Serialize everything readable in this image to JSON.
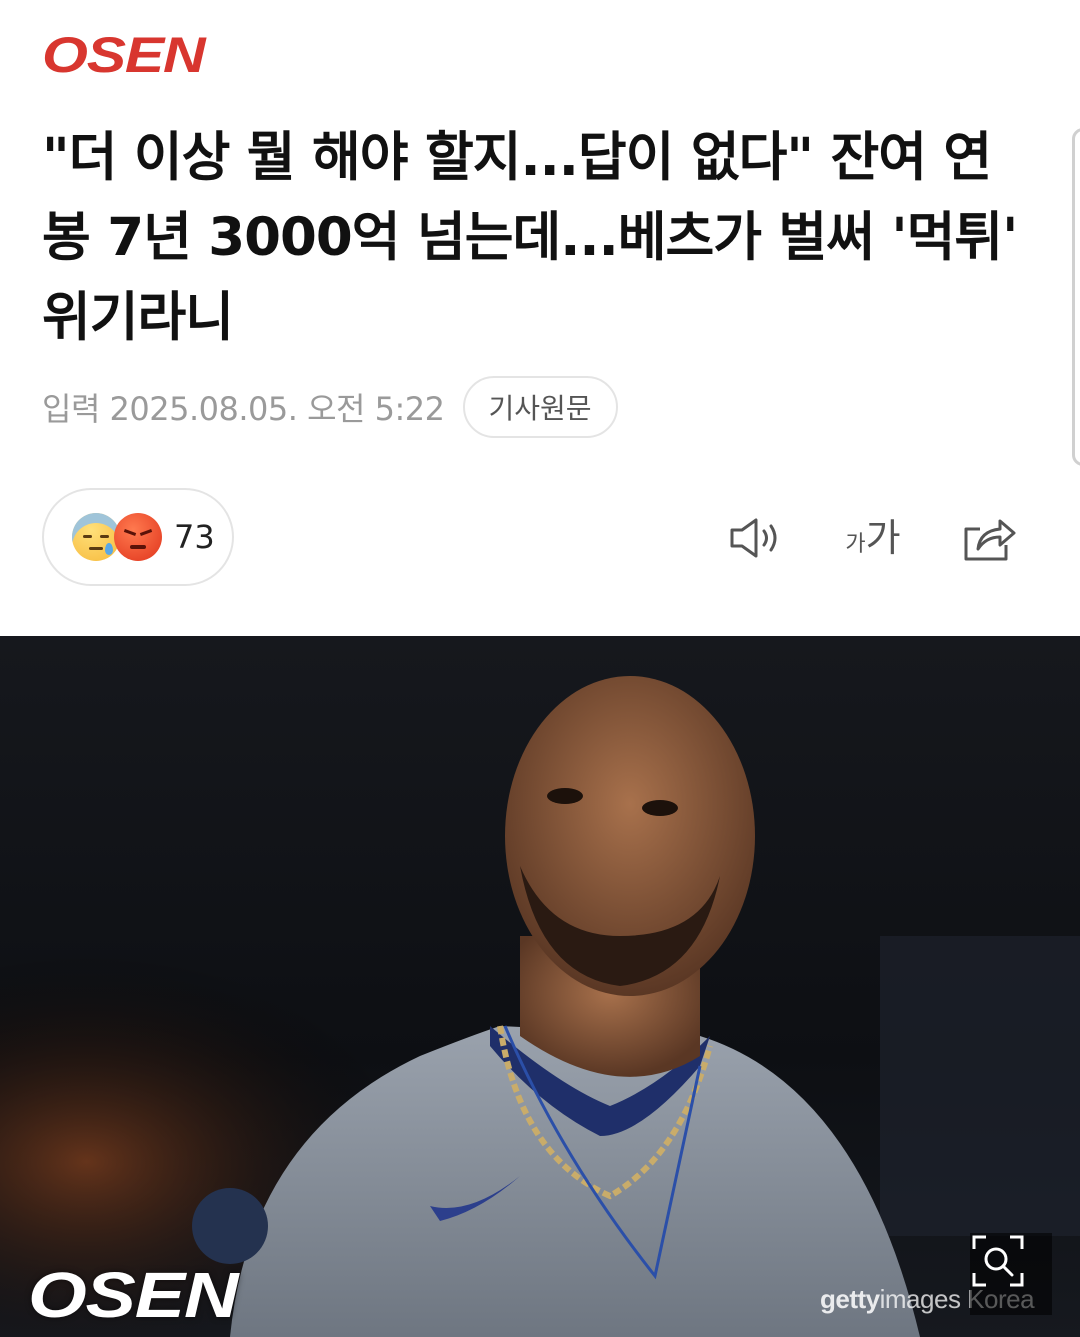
{
  "header": {
    "logo_text": "OSEN",
    "brand_color": "#d8362f"
  },
  "article": {
    "headline": "\"더 이상 뭘 해야 할지...답이 없다\" 잔여 연봉 7년 3000억 넘는데...베츠가 벌써 '먹튀' 위기라니",
    "published": "입력 2025.08.05. 오전 5:22",
    "source_button": "기사원문"
  },
  "reactions": {
    "icons": [
      "sad-face-icon",
      "angry-face-icon"
    ],
    "count": "73"
  },
  "actions": {
    "listen_icon": "speaker-icon",
    "font_size_small": "가",
    "font_size_big": "가",
    "share_icon": "share-icon"
  },
  "photo": {
    "logo_overlay": "OSEN",
    "watermark_brand": "getty",
    "watermark_rest": "images Korea",
    "zoom_icon": "zoom-icon"
  }
}
